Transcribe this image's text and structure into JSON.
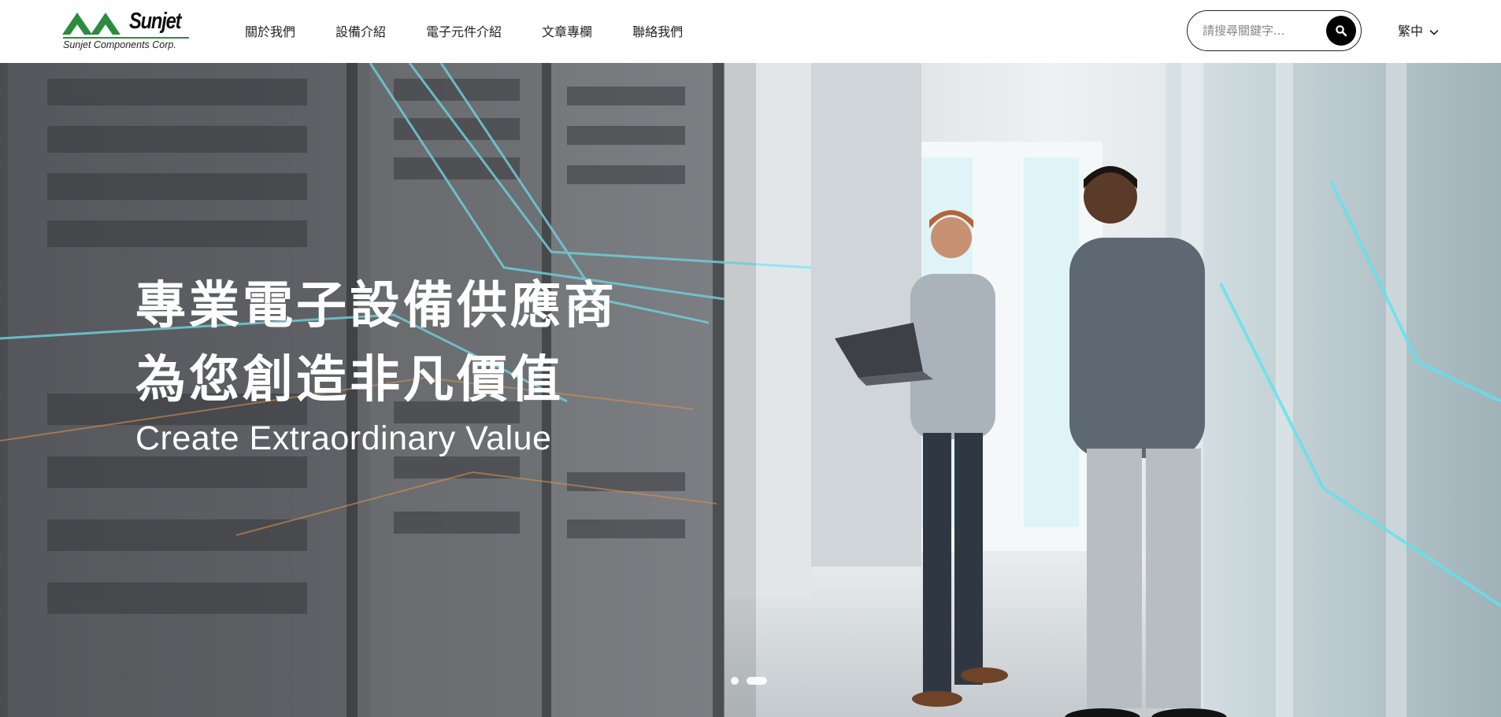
{
  "brand": {
    "name": "Sunjet",
    "subtitle": "Sunjet Components Corp.",
    "colors": {
      "primary": "#2e8b3e",
      "text": "#111111"
    }
  },
  "nav": {
    "items": [
      {
        "label": "關於我們"
      },
      {
        "label": "設備介紹"
      },
      {
        "label": "電子元件介紹"
      },
      {
        "label": "文章專欄"
      },
      {
        "label": "聯絡我們"
      }
    ]
  },
  "search": {
    "placeholder": "請搜尋關鍵字...",
    "value": "",
    "button_icon": "search-icon"
  },
  "language": {
    "current": "繁中",
    "icon": "chevron-down-icon"
  },
  "hero": {
    "headline_line1": "專業電子設備供應商",
    "headline_line2": "為您創造非凡價值",
    "subheadline": "Create Extraordinary Value",
    "slides_total": 2,
    "active_slide": 1
  }
}
